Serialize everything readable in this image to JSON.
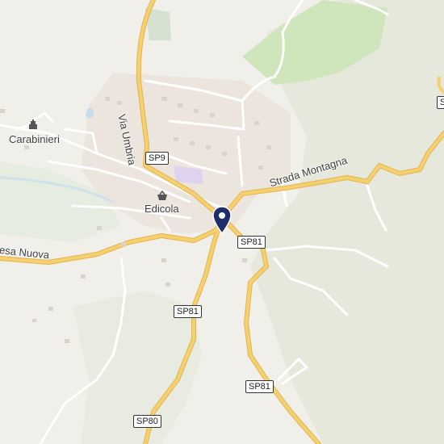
{
  "map": {
    "labels": {
      "carabinieri": "Carabinieri",
      "edicola": "Edicola",
      "via_umbria": "Via Umbria",
      "strada_montagna": "Strada Montagna",
      "road_west": "esa Nuova"
    },
    "road_shields": {
      "sp9": "SP9",
      "sp81_a": "SP81",
      "sp81_b": "SP81",
      "sp81_c": "SP81",
      "sp80": "SP80",
      "edge_right": "S"
    },
    "icons": {
      "police": "police-station-icon",
      "shop": "shopping-basket-icon",
      "marker": "location-pin-icon"
    },
    "colors": {
      "background": "#f1efe9",
      "park": "#d4e8c2",
      "terrain": "#e7e9de",
      "urban": "#ebe5de",
      "major_road": "#f6cf6f",
      "minor_road": "#ffffff",
      "water": "#c6dcef",
      "marker": "#1c2f6b"
    }
  }
}
